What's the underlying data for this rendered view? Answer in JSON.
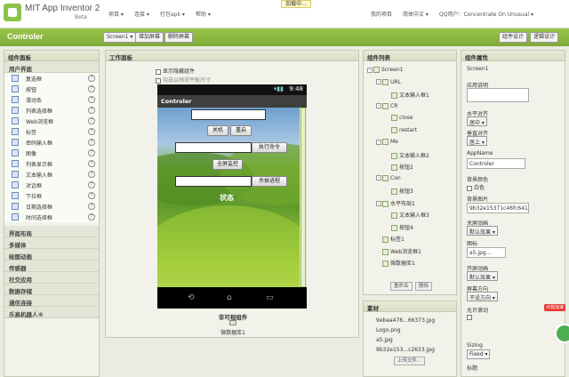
{
  "header": {
    "app_name": "MIT App Inventor 2",
    "beta": "Beta",
    "menu": [
      "项目 ▾",
      "连接 ▾",
      "打包apk ▾",
      "帮助 ▾"
    ],
    "loading": "加载中...",
    "right_menu": [
      "我的项目",
      "简体中文 ▾",
      "QQ用户：Concentrate On Unusual ▾"
    ]
  },
  "toolbar": {
    "project_title": "Controler",
    "screen_select": "Screen1 ▾",
    "add_screen": "增加屏幕",
    "remove_screen": "删除屏幕",
    "designer": "组件设计",
    "blocks": "逻辑设计"
  },
  "palette": {
    "title": "组件面板",
    "ui_group": "用户界面",
    "items": [
      "复选框",
      "按钮",
      "滑动条",
      "列表选择框",
      "Web浏览框",
      "标签",
      "密码输入框",
      "图像",
      "列表显示框",
      "文本输入框",
      "对话框",
      "下拉框",
      "日期选择框",
      "时间选择框"
    ],
    "groups": [
      "界面布局",
      "多媒体",
      "绘图动画",
      "传感器",
      "社交应用",
      "数据存储",
      "通信连接",
      "乐高机器人®"
    ]
  },
  "viewer": {
    "title": "工作面板",
    "show_hidden": "显示隐藏组件",
    "tablet_size": "勾选以预览平板尺寸",
    "clock": "9:48",
    "screen_title": "Controler",
    "btn_shutdown": "关机",
    "btn_restart": "重启",
    "btn_exec": "执行命令",
    "btn_fullscreen": "全屏监控",
    "btn_kill": "杀掉进程",
    "status": "状态",
    "nonvisible_title": "非可视组件",
    "nonvisible_item": "微数据库1"
  },
  "components": {
    "title": "组件列表",
    "tree": [
      {
        "label": "Screen1",
        "level": 0,
        "toggle": "-"
      },
      {
        "label": "URL",
        "level": 1,
        "toggle": "-"
      },
      {
        "label": "文本输入框1",
        "level": 2,
        "toggle": ""
      },
      {
        "label": "CR",
        "level": 1,
        "toggle": "-"
      },
      {
        "label": "close",
        "level": 2,
        "toggle": ""
      },
      {
        "label": "restart",
        "level": 2,
        "toggle": ""
      },
      {
        "label": "Me",
        "level": 1,
        "toggle": "-"
      },
      {
        "label": "文本输入框2",
        "level": 2,
        "toggle": ""
      },
      {
        "label": "按钮2",
        "level": 2,
        "toggle": ""
      },
      {
        "label": "Con",
        "level": 1,
        "toggle": "-"
      },
      {
        "label": "按钮3",
        "level": 2,
        "toggle": ""
      },
      {
        "label": "水平布局1",
        "level": 1,
        "toggle": "-"
      },
      {
        "label": "文本输入框3",
        "level": 2,
        "toggle": ""
      },
      {
        "label": "按钮4",
        "level": 2,
        "toggle": ""
      },
      {
        "label": "标签1",
        "level": 1,
        "toggle": ""
      },
      {
        "label": "Web浏览框1",
        "level": 1,
        "toggle": ""
      },
      {
        "label": "微数据库1",
        "level": 1,
        "toggle": ""
      }
    ],
    "rename": "重命名",
    "delete": "删除"
  },
  "media": {
    "title": "素材",
    "items": [
      "9ebea476...66373.jpg",
      "Logo.png",
      "a5.jpg",
      "9b32e153...c2633.jpg"
    ],
    "upload": "上传文件..."
  },
  "properties": {
    "title": "组件属性",
    "component": "Screen1",
    "about_label": "应用说明",
    "halign_label": "水平对齐",
    "halign_value": "居中 ▾",
    "valign_label": "垂直对齐",
    "valign_value": "居上 ▾",
    "appname_label": "AppName",
    "appname_value": "Controler",
    "bgcolor_label": "背景颜色",
    "bgcolor_value": "白色",
    "bgimage_label": "背景图片",
    "bgimage_value": "9b32e15371c46fc6414",
    "close_anim_label": "关屏动画",
    "close_anim_value": "默认效果 ▾",
    "icon_label": "图标",
    "icon_value": "a5.jpg...",
    "open_anim_label": "开屏动画",
    "open_anim_value": "默认效果 ▾",
    "orientation_label": "屏幕方向",
    "orientation_value": "不设方向 ▾",
    "scroll_label": "允许滚动",
    "sizing_label": "Sizing",
    "sizing_value": "Fixed ▾",
    "title_label": "标题"
  },
  "fab_badge": "点我加速"
}
